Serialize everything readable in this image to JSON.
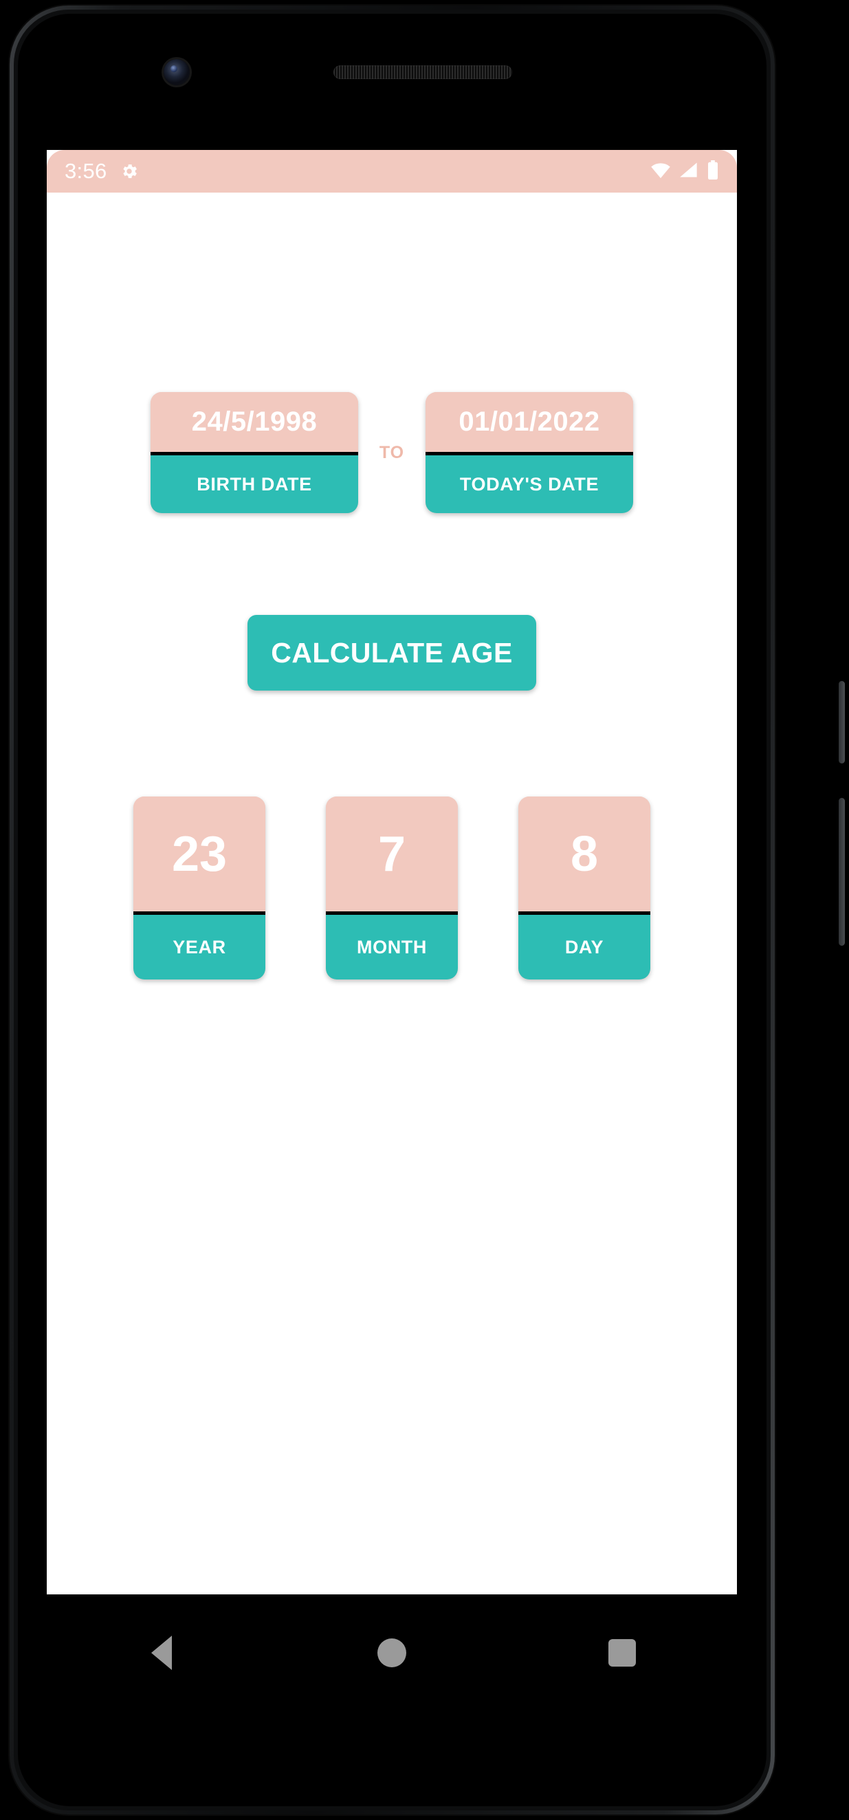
{
  "status_bar": {
    "clock": "3:56",
    "settings_icon": "gear-icon",
    "wifi_icon": "wifi-icon",
    "signal_icon": "cell-signal-icon",
    "battery_icon": "battery-full-icon"
  },
  "dates": {
    "birth": {
      "value": "24/5/1998",
      "label": "BIRTH DATE"
    },
    "separator": "TO",
    "today": {
      "value": "01/01/2022",
      "label": "TODAY'S DATE"
    }
  },
  "actions": {
    "calculate_label": "CALCULATE AGE"
  },
  "results": [
    {
      "value": "23",
      "label": "YEAR"
    },
    {
      "value": "7",
      "label": "MONTH"
    },
    {
      "value": "8",
      "label": "DAY"
    }
  ],
  "nav_bar": {
    "back": "back-nav-icon",
    "home": "home-nav-icon",
    "recent": "recent-apps-nav-icon"
  },
  "colors": {
    "pink": "#F2C9BF",
    "teal": "#2DBDB4",
    "divider": "#000000",
    "text_on_card": "#FFFFFF",
    "to_label": "#EFB9AA"
  }
}
